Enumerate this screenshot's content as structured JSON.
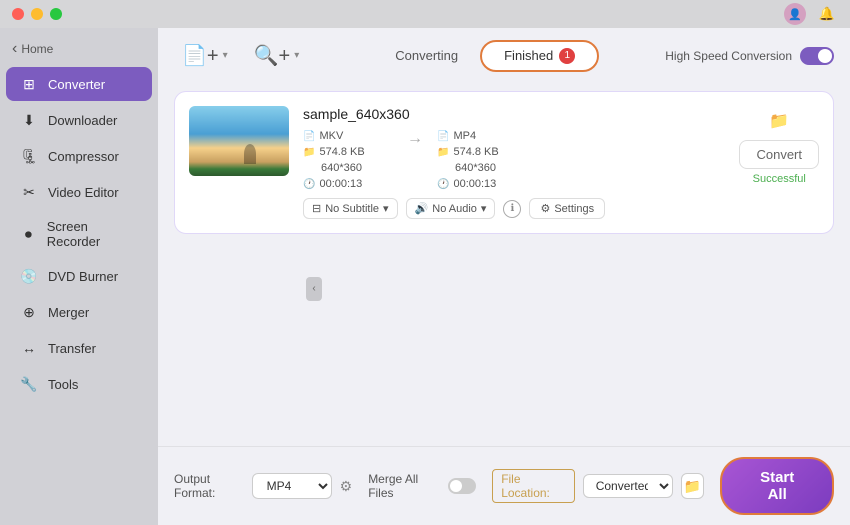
{
  "titlebar": {
    "home_label": "Home",
    "user_icon": "👤",
    "bell_icon": "🔔"
  },
  "sidebar": {
    "items": [
      {
        "id": "converter",
        "label": "Converter",
        "icon": "⊞",
        "active": true
      },
      {
        "id": "downloader",
        "label": "Downloader",
        "icon": "⬇"
      },
      {
        "id": "compressor",
        "label": "Compressor",
        "icon": "🗜"
      },
      {
        "id": "video-editor",
        "label": "Video Editor",
        "icon": "✂"
      },
      {
        "id": "screen-recorder",
        "label": "Screen Recorder",
        "icon": "⏺"
      },
      {
        "id": "dvd-burner",
        "label": "DVD Burner",
        "icon": "💿"
      },
      {
        "id": "merger",
        "label": "Merger",
        "icon": "⊕"
      },
      {
        "id": "transfer",
        "label": "Transfer",
        "icon": "↔"
      },
      {
        "id": "tools",
        "label": "Tools",
        "icon": "🔧"
      }
    ]
  },
  "toolbar": {
    "add_file_icon": "📄",
    "add_btn_label": "",
    "add_folder_icon": "📁",
    "tabs": {
      "converting": "Converting",
      "finished": "Finished",
      "finished_badge": "1"
    },
    "hsc_label": "High Speed Conversion"
  },
  "file_card": {
    "name": "sample_640x360",
    "source": {
      "format": "MKV",
      "resolution": "640*360",
      "size": "574.8 KB",
      "duration": "00:00:13"
    },
    "target": {
      "format": "MP4",
      "resolution": "640*360",
      "size": "574.8 KB",
      "duration": "00:00:13"
    },
    "subtitle": "No Subtitle",
    "audio": "No Audio",
    "settings_label": "Settings",
    "convert_label": "Convert",
    "successful_label": "Successful"
  },
  "bottom_bar": {
    "output_format_label": "Output Format:",
    "output_format_value": "MP4",
    "merge_all_label": "Merge All Files",
    "file_location_label": "File Location:",
    "file_location_value": "Converted",
    "start_all_label": "Start All"
  }
}
